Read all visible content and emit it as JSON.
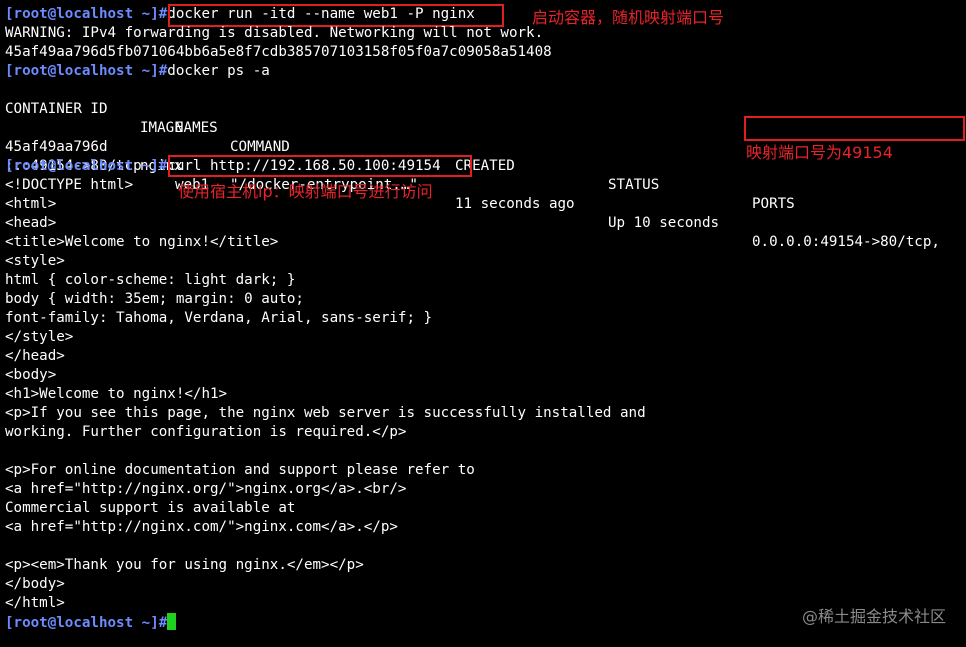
{
  "prompt": "[root@localhost ~]#",
  "commands": {
    "run": "docker run -itd --name web1 -P nginx",
    "ps": "docker ps -a",
    "curl": "curl http://192.168.50.100:49154"
  },
  "output": {
    "warning": "WARNING: IPv4 forwarding is disabled. Networking will not work.",
    "container_hash": "45af49aa796d5fb071064bb6a5e8f7cdb385707103158f05f0a7c09058a51408"
  },
  "ps_table": {
    "headers": {
      "container_id": "CONTAINER ID",
      "image": "IMAGE",
      "command": "COMMAND",
      "created": "CREATED",
      "status": "STATUS",
      "ports": "PORTS",
      "names": "NAMES"
    },
    "row": {
      "container_id": "45af49aa796d",
      "image": "nginx",
      "command": "\"/docker-entrypoint.…\"",
      "created": "11 seconds ago",
      "status": "Up 10 seconds",
      "ports": "0.0.0.0:49154->80/tcp,",
      "ports_cont": ":::49154->80/tcp",
      "names": "web1"
    }
  },
  "html_lines": [
    "<!DOCTYPE html>",
    "<html>",
    "<head>",
    "<title>Welcome to nginx!</title>",
    "<style>",
    "html { color-scheme: light dark; }",
    "body { width: 35em; margin: 0 auto;",
    "font-family: Tahoma, Verdana, Arial, sans-serif; }",
    "</style>",
    "</head>",
    "<body>",
    "<h1>Welcome to nginx!</h1>",
    "<p>If you see this page, the nginx web server is successfully installed and",
    "working. Further configuration is required.</p>",
    "",
    "<p>For online documentation and support please refer to",
    "<a href=\"http://nginx.org/\">nginx.org</a>.<br/>",
    "Commercial support is available at",
    "<a href=\"http://nginx.com/\">nginx.com</a>.</p>",
    "",
    "<p><em>Thank you for using nginx.</em></p>",
    "</body>",
    "</html>"
  ],
  "annotations": {
    "run_note": "启动容器，随机映射端口号",
    "port_note": "映射端口号为49154",
    "curl_note": "使用宿主机ip：映射端口号进行访问"
  },
  "watermark": "@稀土掘金技术社区",
  "colors": {
    "background": "#000000",
    "text": "#ffffff",
    "prompt": "#6d8cff",
    "annotation": "#e8232a",
    "cursor": "#22d022"
  }
}
